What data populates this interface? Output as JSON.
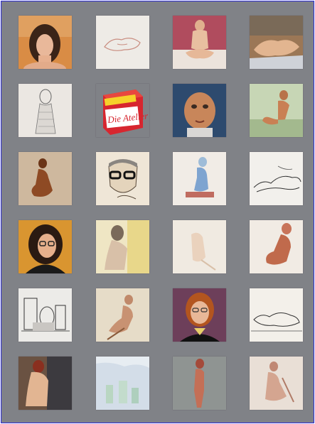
{
  "gallery": {
    "title": "",
    "thumbnails": [
      {
        "label": "",
        "subject": "woman-portrait-painting"
      },
      {
        "label": "",
        "subject": "reclining-nude-sketch"
      },
      {
        "label": "",
        "subject": "seated-nude-painting"
      },
      {
        "label": "",
        "subject": "reclining-nude-painting"
      },
      {
        "label": "",
        "subject": "man-pencil-sketch"
      },
      {
        "label": "Die Atelier",
        "subject": "red-box-logo"
      },
      {
        "label": "",
        "subject": "man-portrait-painting"
      },
      {
        "label": "",
        "subject": "seated-male-nude-painting"
      },
      {
        "label": "",
        "subject": "crouching-figure-painting"
      },
      {
        "label": "",
        "subject": "man-glasses-drawing"
      },
      {
        "label": "",
        "subject": "blue-nude-watercolor"
      },
      {
        "label": "",
        "subject": "reclining-line-drawing"
      },
      {
        "label": "",
        "subject": "woman-glasses-portrait"
      },
      {
        "label": "",
        "subject": "woman-profile-painting"
      },
      {
        "label": "",
        "subject": "faint-figure-watercolor"
      },
      {
        "label": "",
        "subject": "red-chalk-figure"
      },
      {
        "label": "",
        "subject": "still-life-sketch"
      },
      {
        "label": "",
        "subject": "seated-figure-sepia"
      },
      {
        "label": "",
        "subject": "redhead-portrait"
      },
      {
        "label": "",
        "subject": "reclining-ink-sketch"
      },
      {
        "label": "",
        "subject": "back-nude-painting"
      },
      {
        "label": "",
        "subject": "bottles-still-life"
      },
      {
        "label": "",
        "subject": "standing-nude-painting"
      },
      {
        "label": "",
        "subject": "seated-nude-chalk"
      }
    ]
  },
  "colors": {
    "background": "#808287",
    "border": "#2b2bd6"
  }
}
